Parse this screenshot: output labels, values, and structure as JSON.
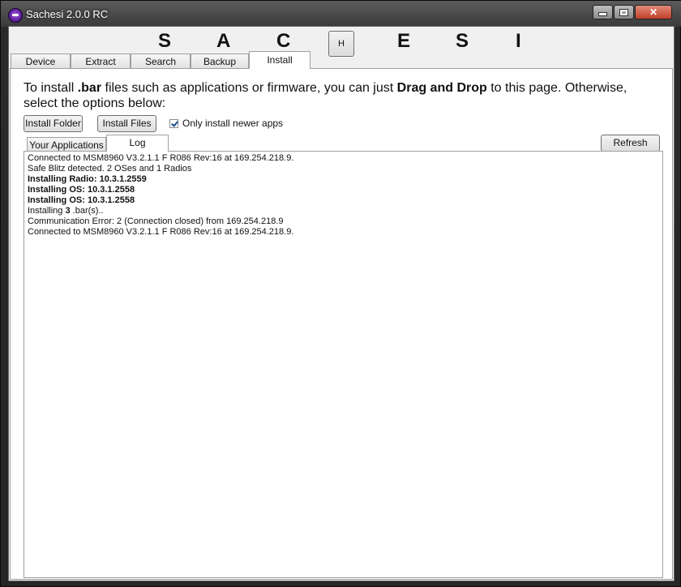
{
  "window": {
    "title": "Sachesi 2.0.0 RC",
    "accent": "#6a1fb0"
  },
  "banner": {
    "letters": [
      "S",
      "A",
      "C",
      "E",
      "S",
      "I"
    ],
    "h_button": "H"
  },
  "main_tabs": [
    {
      "label": "Device"
    },
    {
      "label": "Extract"
    },
    {
      "label": "Search"
    },
    {
      "label": "Backup"
    },
    {
      "label": "Install",
      "active": true
    }
  ],
  "install": {
    "intro_1": "To install ",
    "intro_bold_1": ".bar",
    "intro_2": " files such as applications or firmware, you can just ",
    "intro_bold_2": "Drag and Drop",
    "intro_3": " to this page. Otherwise, select the options below:",
    "install_folder_label": "Install Folder",
    "install_files_label": "Install Files",
    "only_newer_label": "Only install newer apps",
    "only_newer_checked": true,
    "refresh_label": "Refresh"
  },
  "sub_tabs": [
    {
      "label": "Your Applications"
    },
    {
      "label": "Log",
      "active": true
    }
  ],
  "log": [
    {
      "text": "Connected to MSM8960 V3.2.1.1 F R086 Rev:16 at 169.254.218.9.",
      "bold": false
    },
    {
      "text": "Safe Blitz detected. 2 OSes and 1 Radios",
      "bold": false
    },
    {
      "text": "Installing Radio: 10.3.1.2559",
      "bold": true
    },
    {
      "text": "Installing OS: 10.3.1.2558",
      "bold": true
    },
    {
      "text": "Installing OS: 10.3.1.2558",
      "bold": true
    },
    {
      "text_pre": "Installing ",
      "text_bold": "3",
      "text_post": " .bar(s)..",
      "bold": false,
      "mixed": true
    },
    {
      "text": "Communication Error: 2 (Connection closed) from 169.254.218.9",
      "bold": false
    },
    {
      "text": "Connected to MSM8960 V3.2.1.1 F R086 Rev:16 at 169.254.218.9.",
      "bold": false
    }
  ]
}
